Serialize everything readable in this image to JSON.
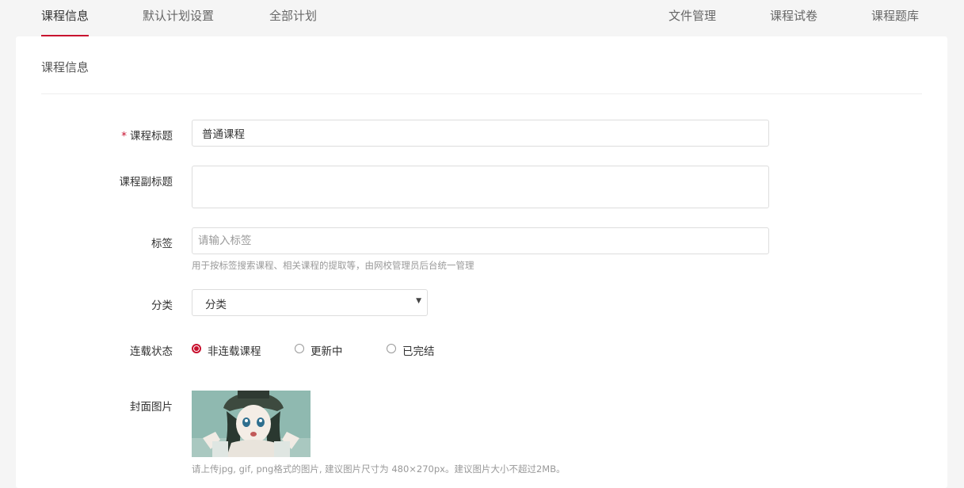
{
  "tabs_left": [
    {
      "label": "课程信息",
      "active": true
    },
    {
      "label": "默认计划设置",
      "active": false
    },
    {
      "label": "全部计划",
      "active": false
    }
  ],
  "tabs_right": [
    {
      "label": "文件管理"
    },
    {
      "label": "课程试卷"
    },
    {
      "label": "课程题库"
    }
  ],
  "section_title": "课程信息",
  "form": {
    "title": {
      "required_mark": "*",
      "label": "课程标题",
      "value": "普通课程"
    },
    "subtitle": {
      "label": "课程副标题",
      "value": ""
    },
    "tags": {
      "label": "标签",
      "placeholder": "请输入标签",
      "help": "用于按标签搜索课程、相关课程的提取等，由网校管理员后台统一管理"
    },
    "category": {
      "label": "分类",
      "value": "分类",
      "caret": "▼"
    },
    "serialize": {
      "label": "连载状态",
      "options": [
        {
          "label": "非连载课程",
          "checked": true
        },
        {
          "label": "更新中",
          "checked": false
        },
        {
          "label": "已完结",
          "checked": false
        }
      ]
    },
    "cover": {
      "label": "封面图片",
      "help": "请上传jpg, gif, png格式的图片, 建议图片尺寸为 480×270px。建议图片大小不超过2MB。"
    }
  },
  "colors": {
    "accent": "#c8102e",
    "page_bg": "#f5f5f5",
    "card_bg": "#ffffff"
  }
}
